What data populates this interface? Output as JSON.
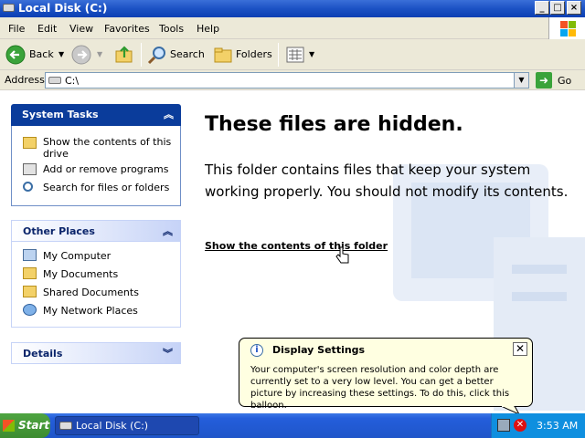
{
  "window": {
    "title": "Local Disk (C:)",
    "controls": [
      "_",
      "□",
      "×"
    ]
  },
  "menu": [
    "File",
    "Edit",
    "View",
    "Favorites",
    "Tools",
    "Help"
  ],
  "toolbar": {
    "back": "Back",
    "search": "Search",
    "folders": "Folders"
  },
  "address": {
    "label": "Address",
    "value": "C:\\",
    "go": "Go"
  },
  "system_tasks": {
    "header": "System Tasks",
    "items": [
      {
        "line1": "Show the contents of this",
        "line2": "drive",
        "icon": "folder-view-icon"
      },
      {
        "line1": "Add or remove programs",
        "line2": "",
        "icon": "programs-icon"
      },
      {
        "line1": "Search for files or folders",
        "line2": "",
        "icon": "search-icon"
      }
    ]
  },
  "other_places": {
    "header": "Other Places",
    "items": [
      {
        "label": "My Computer",
        "icon": "computer-icon"
      },
      {
        "label": "My Documents",
        "icon": "documents-icon"
      },
      {
        "label": "Shared Documents",
        "icon": "folder-icon"
      },
      {
        "label": "My Network Places",
        "icon": "network-icon"
      }
    ]
  },
  "details": {
    "header": "Details"
  },
  "main": {
    "heading": "These files are hidden.",
    "body": "This folder contains files that keep your system working properly. You should not modify its contents.",
    "link": "Show the contents of this folder"
  },
  "balloon": {
    "title": "Display Settings",
    "body": "Your computer's screen resolution and color depth are currently set to a very low level. You can get a better picture by increasing these settings. To do this, click this balloon."
  },
  "taskbar": {
    "start": "Start",
    "task": "Local Disk (C:)",
    "clock": "3:53 AM"
  }
}
